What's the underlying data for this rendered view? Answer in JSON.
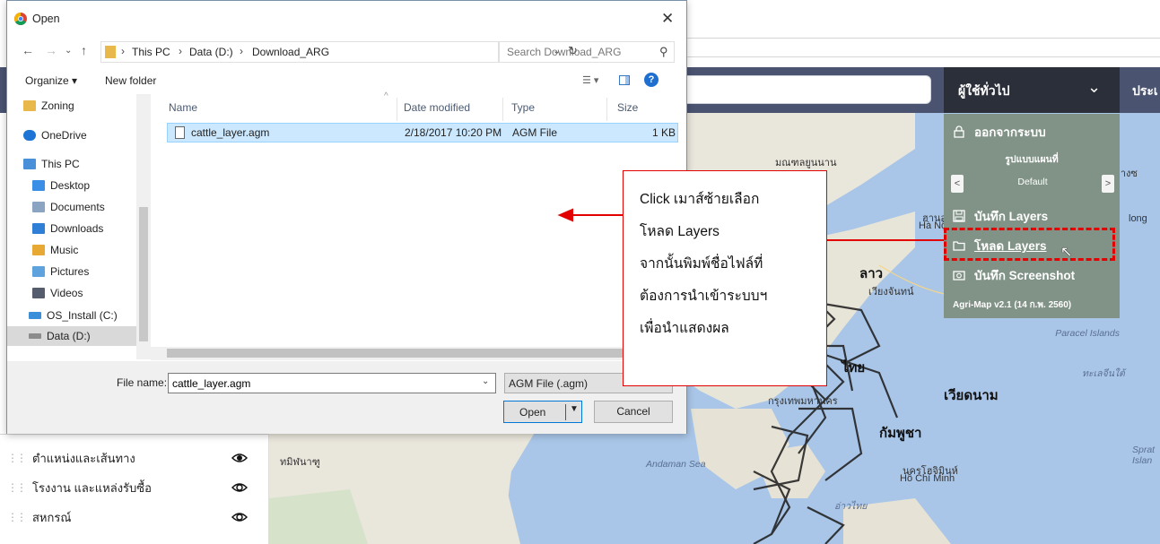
{
  "app": {
    "user_menu_label": "ผู้ใช้ทั่วไป",
    "lang_label": "ประเ",
    "menu": {
      "logout": "ออกจากระบบ",
      "map_style_title": "รูปแบบแผนที่",
      "map_style_value": "Default",
      "save_layers": "บันทึก Layers",
      "load_layers": "โหลด Layers",
      "save_screenshot": "บันทึก Screenshot",
      "version": "Agri-Map v2.1 (14 ก.พ. 2560)"
    },
    "layers": [
      {
        "label": "ตำแหน่งและเส้นทาง"
      },
      {
        "label": "โรงงาน และแหล่งรับซื้อ"
      },
      {
        "label": "สหกรณ์"
      }
    ],
    "map_labels": {
      "myanmar": "มณฑลยูนนาน",
      "laos": "ลาว",
      "vientiane": "เวียงจันทน์",
      "hanoi_th": "ฮานอย",
      "hanoi": "Hà Nội",
      "vietnam": "เวียดนาม",
      "cambodia": "กัมพูชา",
      "bangkok": "กรุงเทพมหานคร",
      "hcm_th": "นครโฮจิมินห์",
      "hcm": "Hồ Chí Minh",
      "andaman": "Andaman Sea",
      "paracel": "Paracel Islands",
      "south_china_sea": "ทะเลจีนใต้",
      "gulf": "อ่าวไทย",
      "indian_ocean": "ทมิฬนาฑู",
      "long": "long",
      "spratly": "Sprat Islan",
      "thai": "ไทย",
      "guangxi": "กวางซ"
    }
  },
  "dialog": {
    "title": "Open",
    "close": "✕",
    "path": [
      "This PC",
      "Data (D:)",
      "Download_ARG"
    ],
    "search_placeholder": "Search Download_ARG",
    "organize": "Organize ▾",
    "new_folder": "New folder",
    "nav_items": [
      {
        "label": "Zoning",
        "color": "#e8b84a"
      },
      {
        "label": "OneDrive",
        "color": "#1e74d4"
      },
      {
        "label": "This PC",
        "color": "#4a90d9"
      },
      {
        "label": "Desktop",
        "color": "#3a8ee6"
      },
      {
        "label": "Documents",
        "color": "#8aa4c2"
      },
      {
        "label": "Downloads",
        "color": "#2f7fd6"
      },
      {
        "label": "Music",
        "color": "#e8a834"
      },
      {
        "label": "Pictures",
        "color": "#5ea3dd"
      },
      {
        "label": "Videos",
        "color": "#555c6e"
      },
      {
        "label": "OS_Install (C:)",
        "color": "#3b8ed8"
      },
      {
        "label": "Data (D:)",
        "color": "#8c8c8c"
      }
    ],
    "columns": {
      "name": "Name",
      "date": "Date modified",
      "type": "Type",
      "size": "Size"
    },
    "file": {
      "name": "cattle_layer.agm",
      "date": "2/18/2017 10:20 PM",
      "type": "AGM File",
      "size": "1 KB"
    },
    "file_name_label": "File name:",
    "file_name_value": "cattle_layer.agm",
    "file_type": "AGM File (.agm)",
    "open_label": "Open",
    "cancel_label": "Cancel"
  },
  "callout": {
    "lines": [
      "Click เมาส์ซ้ายเลือก",
      "โหลด Layers",
      "จากนั้นพิมพ์ชื่อไฟล์ที่",
      "ต้องการนำเข้าระบบฯ",
      "เพื่อนำแสดงผล"
    ],
    "color": "#e30000"
  }
}
